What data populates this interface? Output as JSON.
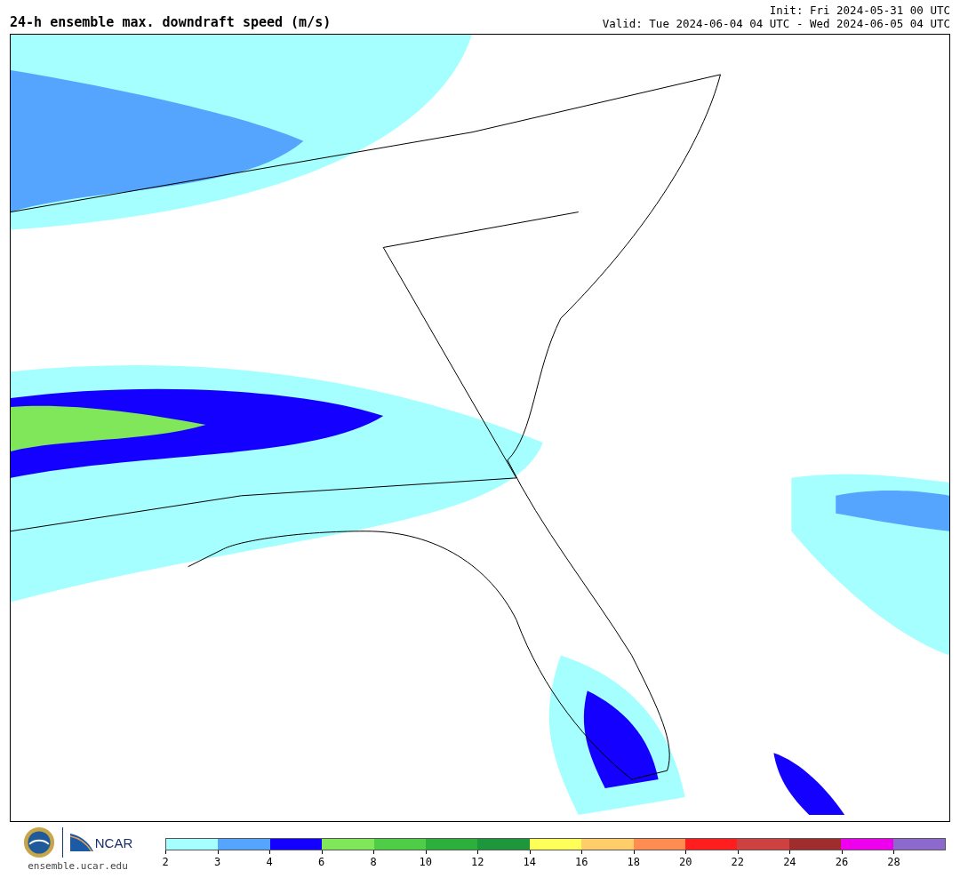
{
  "header": {
    "title": "24-h ensemble max. downdraft speed (m/s)",
    "init": "Init: Fri 2024-05-31 00 UTC",
    "valid": "Valid: Tue 2024-06-04 04 UTC - Wed 2024-06-05 04 UTC"
  },
  "footer": {
    "logo_text": "NCAR",
    "url": "ensemble.ucar.edu"
  },
  "colorbar": {
    "segments": [
      {
        "color": "#a5ffff",
        "label": "2"
      },
      {
        "color": "#55a5ff",
        "label": "3"
      },
      {
        "color": "#1400ff",
        "label": "4"
      },
      {
        "color": "#80e65a",
        "label": "6"
      },
      {
        "color": "#50cd46",
        "label": "8"
      },
      {
        "color": "#2daf3c",
        "label": "10"
      },
      {
        "color": "#1e963c",
        "label": "12"
      },
      {
        "color": "#ffff5a",
        "label": "14"
      },
      {
        "color": "#ffcd69",
        "label": "16"
      },
      {
        "color": "#ff8c50",
        "label": "18"
      },
      {
        "color": "#ff1e1e",
        "label": "20"
      },
      {
        "color": "#cd4140",
        "label": "22"
      },
      {
        "color": "#a02d2d",
        "label": "24"
      },
      {
        "color": "#ee00ee",
        "label": "26"
      },
      {
        "color": "#8c69cc",
        "label": "28"
      }
    ]
  }
}
